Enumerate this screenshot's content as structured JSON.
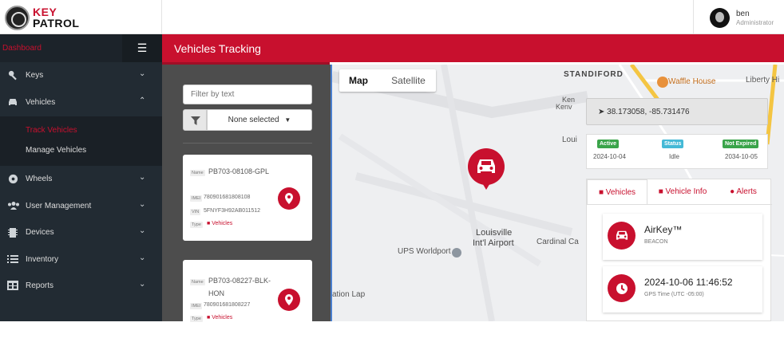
{
  "brand": {
    "line1": "KEY",
    "line2": "PATROL"
  },
  "user": {
    "name": "ben",
    "role": "Administrator"
  },
  "sidebar": {
    "dashboard": "Dashboard",
    "items": [
      {
        "label": "Keys",
        "icon": "key-icon"
      },
      {
        "label": "Vehicles",
        "icon": "car-icon"
      },
      {
        "label": "Wheels",
        "icon": "wheel-icon"
      },
      {
        "label": "User Management",
        "icon": "users-icon"
      },
      {
        "label": "Devices",
        "icon": "chip-icon"
      },
      {
        "label": "Inventory",
        "icon": "list-icon"
      },
      {
        "label": "Reports",
        "icon": "table-icon"
      }
    ],
    "sub_items": [
      "Track Vehicles",
      "Manage Vehicles"
    ]
  },
  "page": {
    "title": "Vehicles Tracking"
  },
  "filter": {
    "placeholder": "Filter by text",
    "select_label": "None selected"
  },
  "cards": [
    {
      "name_label": "Name",
      "name": "PB703-08108-GPL",
      "imei_label": "IMEI",
      "imei": "780901681808108",
      "vin_label": "VIN",
      "vin": "5FNYF3H92AB011512",
      "type_label": "Type",
      "type": "Vehicles"
    },
    {
      "name_label": "Name",
      "name": "PB703-08227-BLK-HON",
      "imei_label": "IMEI",
      "imei": "780901681808227",
      "type_label": "Type",
      "type": "Vehicles"
    }
  ],
  "map": {
    "btn_map": "Map",
    "btn_satellite": "Satellite",
    "labels": {
      "standiford": "STANDIFORD",
      "waffle": "Waffle House",
      "liberty": "Liberty Hi",
      "airport1": "Louisville",
      "airport2": "Int'l Airport",
      "ups": "UPS Worldport",
      "cardinal": "Cardinal Ca",
      "lap": "ation Lap",
      "kenv": "Ken",
      "kenv2": "Kenv",
      "louis": "Loui"
    }
  },
  "info": {
    "coords": "38.173058, -85.731476",
    "statuses": [
      {
        "badge": "Active",
        "value": "2024-10-04",
        "color": "#3aa44a"
      },
      {
        "badge": "Status",
        "value": "Idle",
        "color": "#44b9d6"
      },
      {
        "badge": "Not Expired",
        "value": "2034-10-05",
        "color": "#3aa44a"
      }
    ],
    "tabs": [
      "Vehicles",
      "Vehicle Info",
      "Alerts"
    ],
    "details": [
      {
        "title": "AirKey™",
        "sub": "BEACON"
      },
      {
        "title": "2024-10-06 11:46:52",
        "sub": "GPS Time (UTC -05:00)"
      }
    ]
  },
  "colors": {
    "accent": "#c8102e",
    "sidebar": "#222b33"
  }
}
